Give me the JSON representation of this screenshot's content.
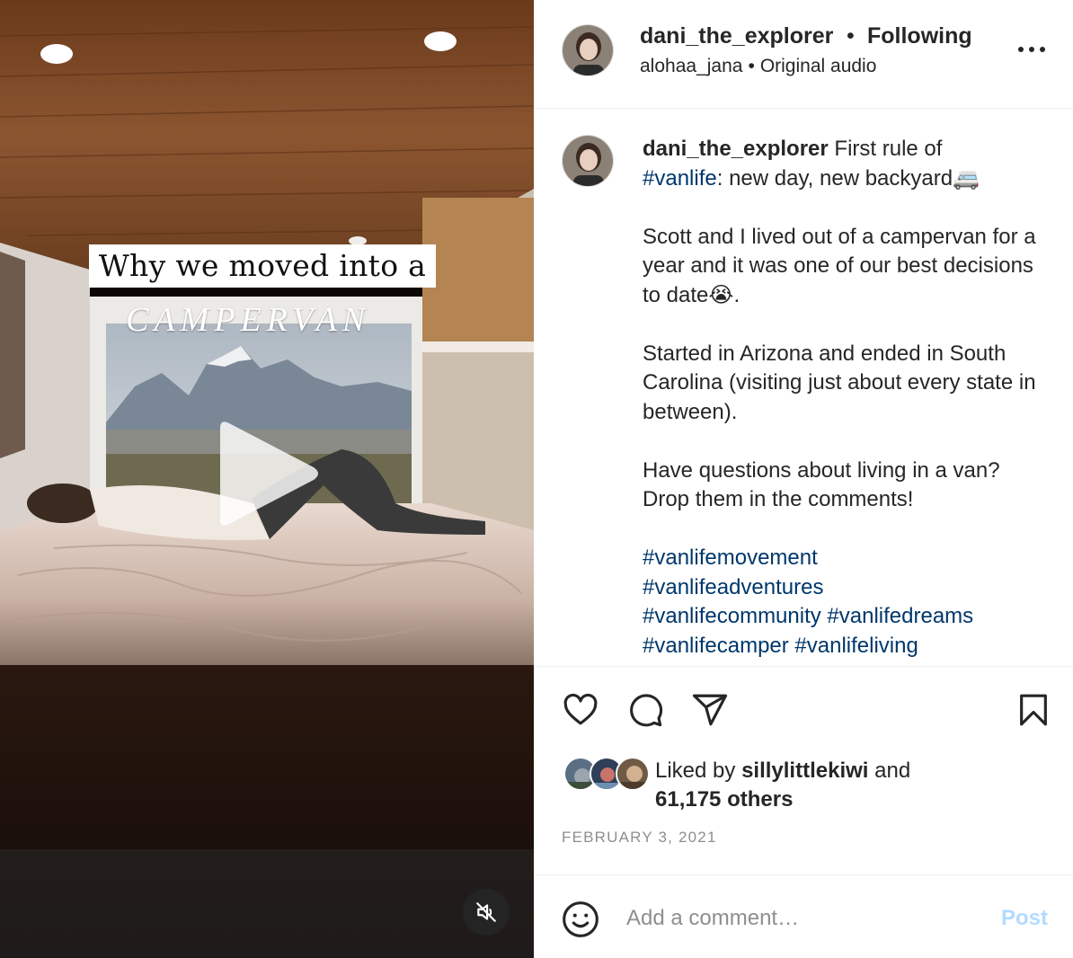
{
  "video": {
    "overlay_line1": "Why we moved into a",
    "overlay_line2": "CAMPERVAN"
  },
  "header": {
    "username": "dani_the_explorer",
    "dot": "•",
    "follow_status": "Following",
    "audio_user": "alohaa_jana",
    "audio_sep": "•",
    "audio_label": "Original audio"
  },
  "caption": {
    "username": "dani_the_explorer",
    "text_before_tag": "First rule of",
    "tag_vanlife": "#vanlife",
    "text_after_tag": ": new day, new backyard🚐",
    "para2": "Scott and I lived out of a campervan for a year and it was one of our best decisions to date😭.",
    "para3": "Started in Arizona and ended in South Carolina (visiting just about every state in between).",
    "para4": "Have questions about living in a van? Drop them in the comments!",
    "hashtags": [
      "#vanlifemovement",
      "#vanlifeadventures",
      "#vanlifecommunity",
      "#vanlifedreams",
      "#vanlifecamper",
      "#vanlifeliving"
    ]
  },
  "likes": {
    "prefix": "Liked by",
    "user": "sillylittlekiwi",
    "middle": "and",
    "others": "61,175 others"
  },
  "date": "FEBRUARY 3, 2021",
  "comment_box": {
    "placeholder": "Add a comment…",
    "post_label": "Post"
  },
  "colors": {
    "link": "#00376b",
    "post_disabled": "#b3dbff",
    "secondary_text": "#8e8e8e"
  },
  "icons": [
    "play-icon",
    "mute-icon",
    "more-icon",
    "heart-icon",
    "comment-icon",
    "share-icon",
    "bookmark-icon",
    "emoji-icon"
  ]
}
